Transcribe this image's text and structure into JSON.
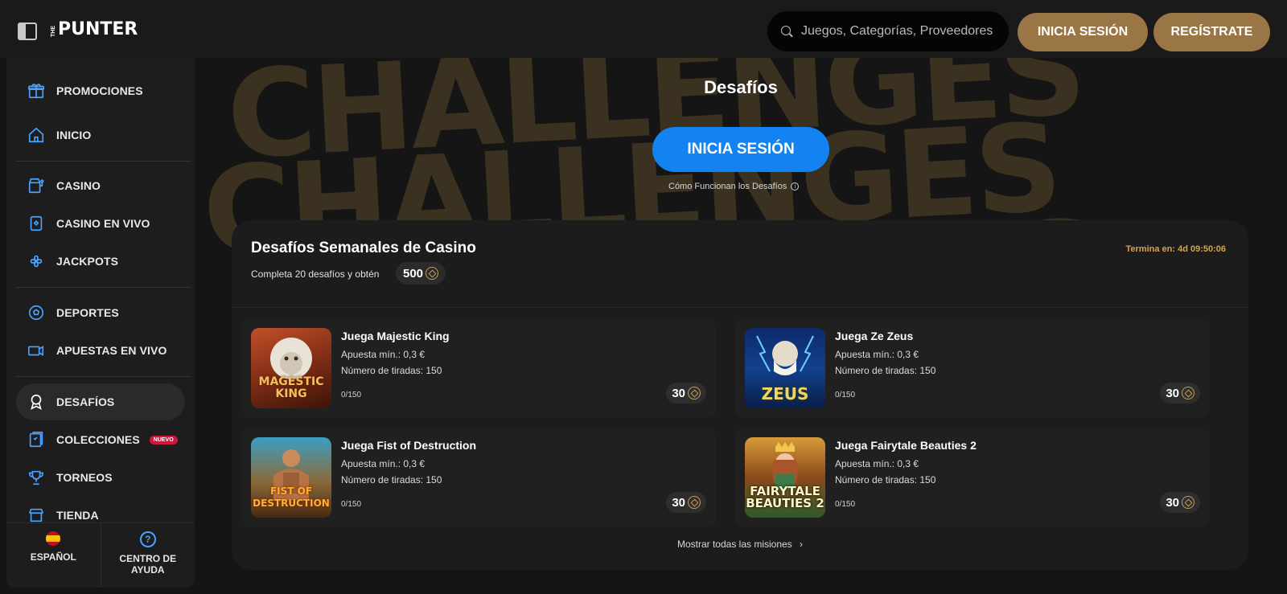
{
  "header": {
    "logo_small": "THE",
    "logo_main": "PUNTER",
    "search_placeholder": "Juegos, Categorías, Proveedores",
    "login_label": "INICIA SESIÓN",
    "register_label": "REGÍSTRATE"
  },
  "sidebar": {
    "items": [
      {
        "label": "PROMOCIONES",
        "icon": "gift-icon"
      },
      {
        "label": "INICIO",
        "icon": "home-icon"
      },
      {
        "label": "CASINO",
        "icon": "slot-icon"
      },
      {
        "label": "CASINO EN VIVO",
        "icon": "card-icon"
      },
      {
        "label": "JACKPOTS",
        "icon": "clover-icon"
      },
      {
        "label": "DEPORTES",
        "icon": "soccer-ball-icon"
      },
      {
        "label": "APUESTAS EN VIVO",
        "icon": "video-icon"
      },
      {
        "label": "DESAFÍOS",
        "icon": "medal-icon"
      },
      {
        "label": "COLECCIONES",
        "icon": "collection-icon",
        "badge": "NUEVO"
      },
      {
        "label": "TORNEOS",
        "icon": "trophy-icon"
      },
      {
        "label": "TIENDA",
        "icon": "shop-icon"
      }
    ],
    "active": "DESAFÍOS",
    "footer": {
      "language": "ESPAÑOL",
      "help": "CENTRO DE AYUDA"
    }
  },
  "hero": {
    "background_word": "CHALLENGES",
    "title": "Desafíos",
    "login_button": "INICIA SESIÓN",
    "how_link": "Cómo Funcionan los Desafíos"
  },
  "weekly": {
    "title": "Desafíos Semanales de Casino",
    "subtitle": "Completa 20 desafíos y obtén",
    "reward": "500",
    "timer": "Termina en: 4d 09:50:06",
    "show_all": "Mostrar todas las misiones",
    "cards": [
      {
        "title": "Juega Majestic King",
        "min_bet": "Apuesta mín.: 0,3 €",
        "spins": "Número de tiradas: 150",
        "progress": "0/150",
        "reward": "30",
        "thumb_text": "MAGESTIC KING"
      },
      {
        "title": "Juega Ze Zeus",
        "min_bet": "Apuesta mín.: 0,3 €",
        "spins": "Número de tiradas: 150",
        "progress": "0/150",
        "reward": "30",
        "thumb_text": "ZEUS"
      },
      {
        "title": "Juega Fist of Destruction",
        "min_bet": "Apuesta mín.: 0,3 €",
        "spins": "Número de tiradas: 150",
        "progress": "0/150",
        "reward": "30",
        "thumb_text": "FIST OF DESTRUCTION"
      },
      {
        "title": "Juega Fairytale Beauties 2",
        "min_bet": "Apuesta mín.: 0,3 €",
        "spins": "Número de tiradas: 150",
        "progress": "0/150",
        "reward": "30",
        "thumb_text": "FAIRYTALE BEAUTIES 2"
      }
    ]
  },
  "colors": {
    "gold": "#9a7647",
    "blue": "#1283f0",
    "timer": "#d4a352",
    "badge": "#d0163a"
  }
}
